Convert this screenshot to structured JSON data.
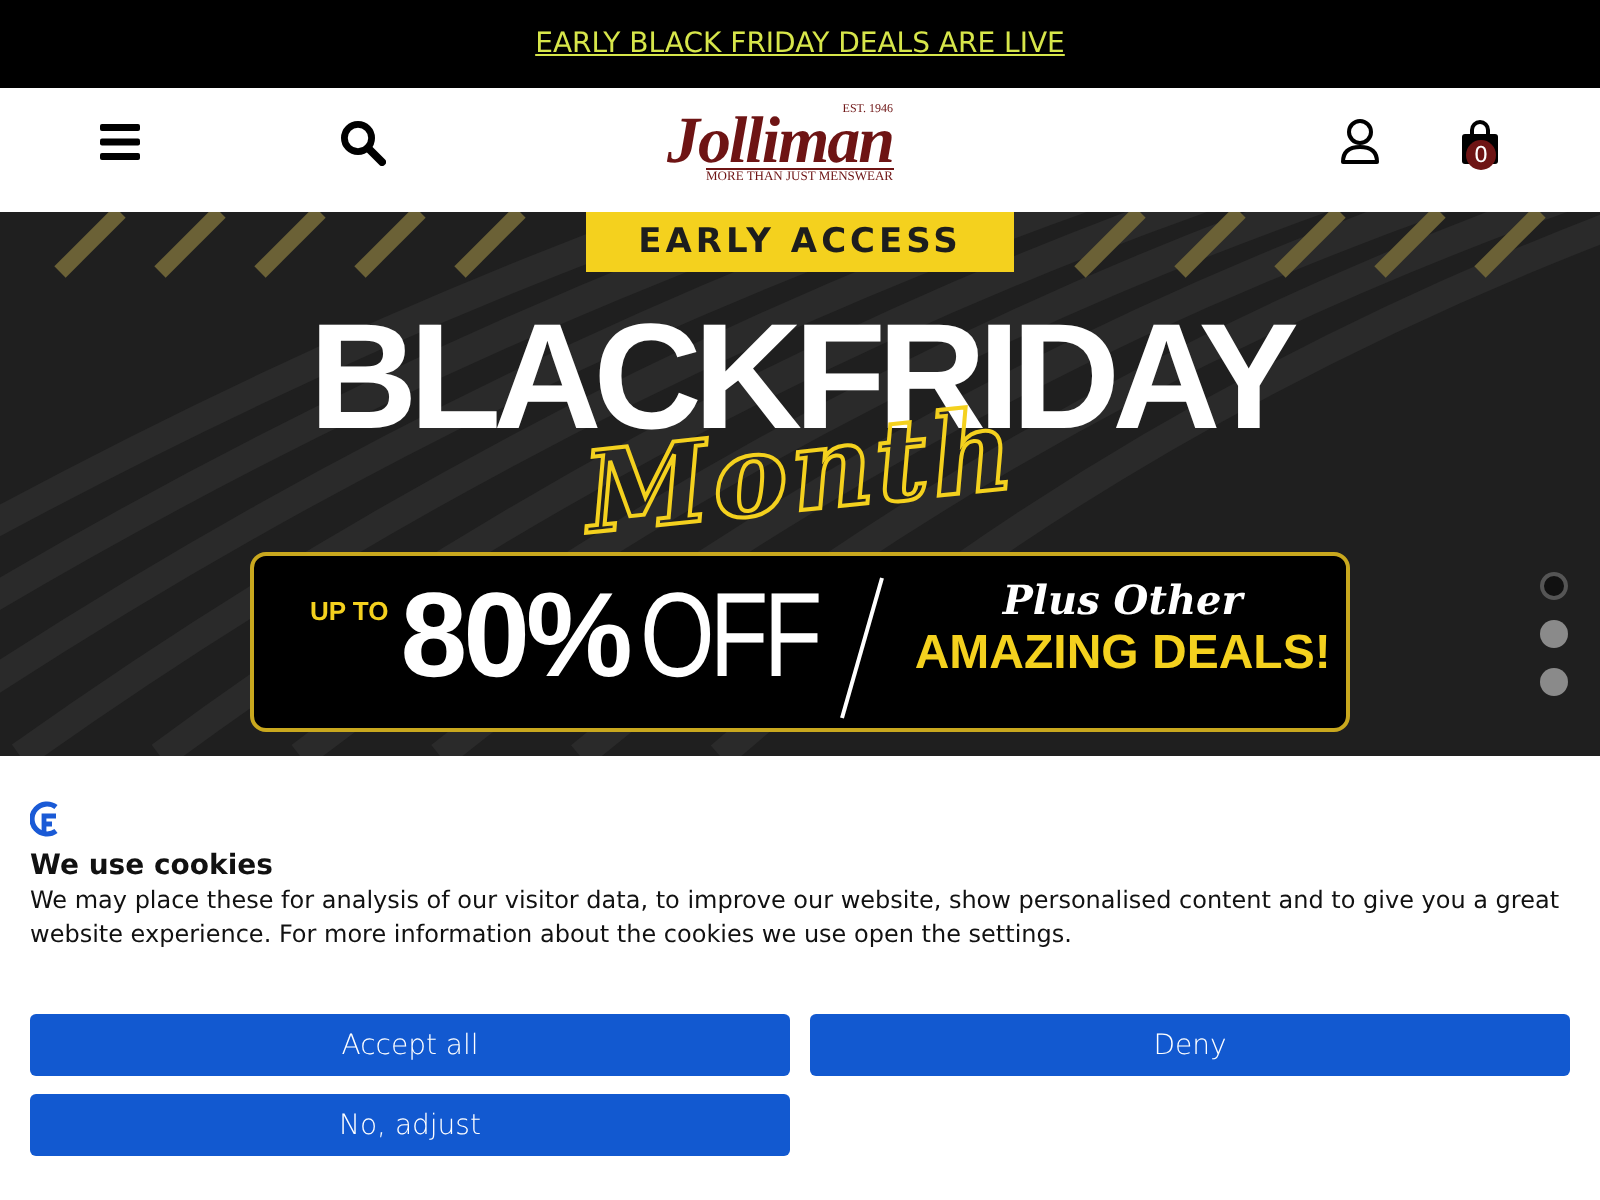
{
  "promo_bar": {
    "link": "EARLY BLACK FRIDAY DEALS ARE LIVE"
  },
  "header": {
    "logo": {
      "est": "EST. 1946",
      "name": "Jolliman",
      "tagline": "MORE THAN JUST MENSWEAR"
    },
    "cart_count": "0"
  },
  "hero": {
    "badge": "EARLY ACCESS",
    "headline": "BLACKFRIDAY",
    "script": "Month",
    "offer": {
      "prefix": "UP TO",
      "amount": "80%",
      "off": "OFF",
      "extra_script": "Plus Other",
      "extra": "AMAZING DEALS!"
    },
    "slides": [
      {
        "selected": true
      },
      {
        "selected": false
      },
      {
        "selected": false
      }
    ]
  },
  "cookie_banner": {
    "title": "We use cookies",
    "text": "We may place these for analysis of our visitor data, to improve our website, show personalised content and to give you a great website experience. For more information about the cookies we use open the settings.",
    "buttons": [
      "Accept all",
      "Deny",
      "No, adjust"
    ]
  }
}
